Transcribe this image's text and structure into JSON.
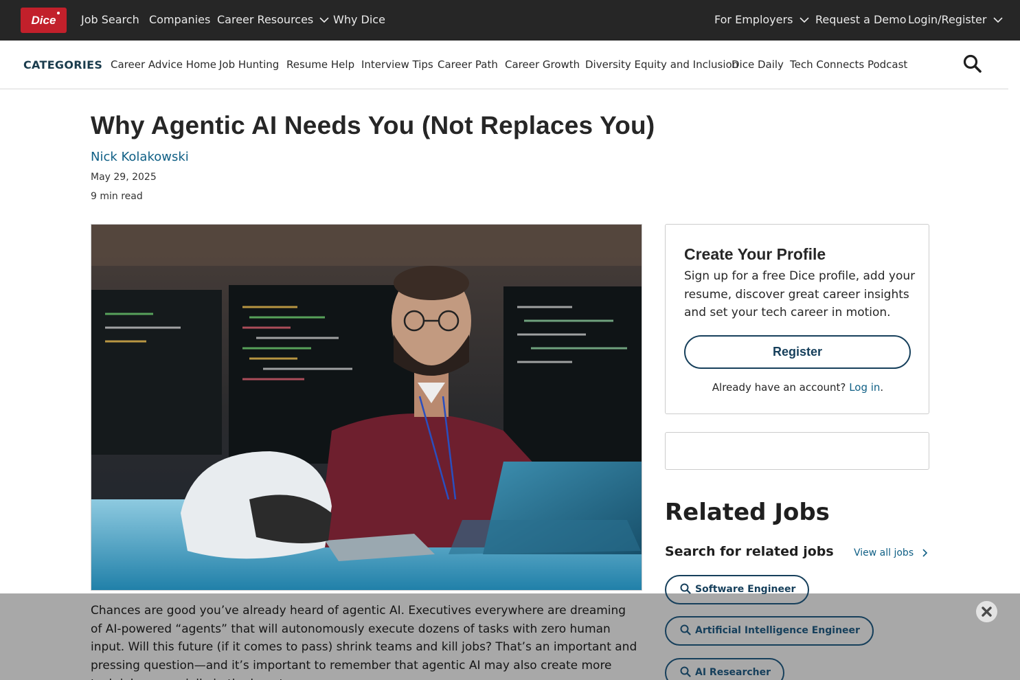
{
  "brand": {
    "logo_text": "Dice",
    "accent": "#c2202b"
  },
  "topnav": {
    "items": [
      "Job Search",
      "Companies",
      "Career Resources",
      "Why Dice"
    ],
    "right_items": [
      "For Employers",
      "Request a Demo",
      "Login/Register"
    ]
  },
  "categories": {
    "title": "CATEGORIES",
    "links": [
      "Career Advice Home",
      "Job Hunting",
      "Resume Help",
      "Interview Tips",
      "Career Path",
      "Career Growth",
      "Diversity Equity and Inclusion",
      "Dice Daily",
      "Tech Connects Podcast"
    ],
    "search_icon": "search-icon"
  },
  "article": {
    "title": "Why Agentic AI Needs You (Not Replaces You)",
    "author": "Nick Kolakowski",
    "date": "May 29, 2025",
    "read_time": "9 min read",
    "body": "Chances are good you’ve already heard of agentic AI. Executives everywhere are dreaming of AI-powered “agents” that will autonomously execute dozens of tasks with zero human input. Will this future (if it comes to pass) shrink teams and kill jobs? That’s an important and pressing question—and it’s important to remember that agentic AI may also create more tech jobs, especially in the long term."
  },
  "profile_card": {
    "title": "Create Your Profile",
    "text": "Sign up for a free Dice profile, add your resume, discover great career insights and set your tech career in motion.",
    "register_label": "Register",
    "login_prompt": "Already have an account?",
    "login_link": "Log in",
    "login_suffix": "."
  },
  "related": {
    "title": "Related Jobs",
    "subtitle": "Search for related jobs",
    "view_all": "View all jobs",
    "jobs": [
      "Software Engineer",
      "Artificial Intelligence Engineer",
      "AI Researcher"
    ]
  },
  "colors": {
    "topbar": "#262626",
    "link": "#0f5f85",
    "button_border": "#163f5b"
  }
}
